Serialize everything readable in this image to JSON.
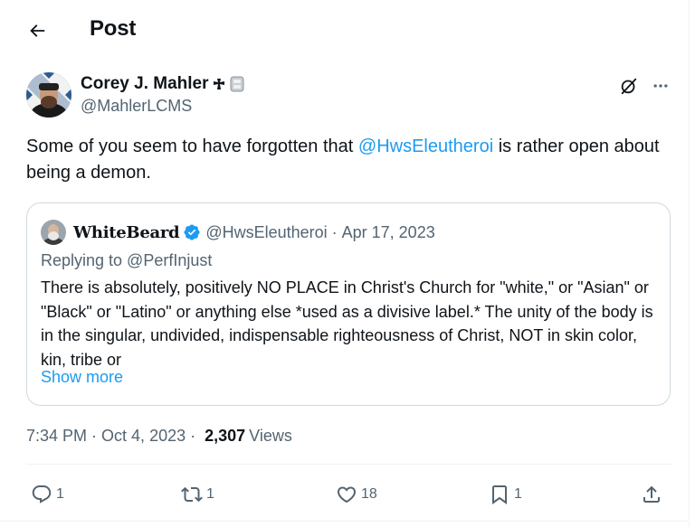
{
  "header": {
    "title": "Post",
    "back_icon": "arrow-left-icon"
  },
  "post": {
    "author_name": "Corey J. Mahler",
    "author_badges": [
      "cross-pattee-icon",
      "emoji-badge-icon"
    ],
    "author_handle": "@MahlerLCMS",
    "text_before": "Some of you seem to have forgotten that ",
    "mention": "@HwsEleutheroi",
    "text_after": " is rather open about being a demon."
  },
  "quote": {
    "name": "WhiteBeard",
    "handle": "@HwsEleutheroi",
    "separator": "·",
    "date": "Apr 17, 2023",
    "replying_to": "Replying to @PerfInjust",
    "body": "There is absolutely, positively NO PLACE in Christ's Church for \"white,\" or \"Asian\" or \"Black\" or \"Latino\" or anything else *used as a divisive label.* The unity of the body is in the singular, undivided, indispensable righteousness of Christ, NOT in skin color, kin, tribe or",
    "show_more": "Show more"
  },
  "meta": {
    "time": "7:34 PM",
    "separator": "·",
    "date": "Oct 4, 2023",
    "views_count": "2,307",
    "views_label": "Views"
  },
  "actions": {
    "reply_count": "1",
    "repost_count": "1",
    "like_count": "18",
    "bookmark_count": "1"
  },
  "colors": {
    "text": "#0f1419",
    "secondary": "#536471",
    "accent": "#1d9bf0",
    "border": "#cfd9de",
    "verified": "#1d9bf0"
  }
}
